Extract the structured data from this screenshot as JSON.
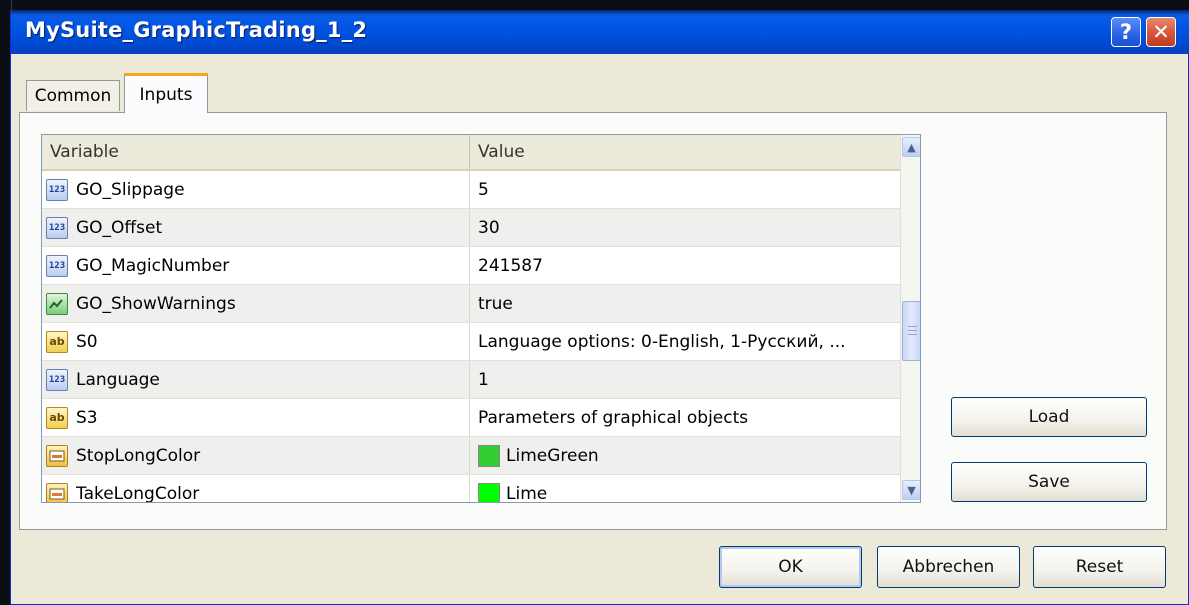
{
  "window": {
    "title": "MySuite_GraphicTrading_1_2",
    "help_label": "?",
    "close_label": "✕"
  },
  "tabs": [
    {
      "label": "Common",
      "active": false
    },
    {
      "label": "Inputs",
      "active": true
    }
  ],
  "grid": {
    "columns": {
      "variable": "Variable",
      "value": "Value"
    },
    "rows": [
      {
        "icon": "number-icon",
        "name": "GO_Slippage",
        "value": "5"
      },
      {
        "icon": "number-icon",
        "name": "GO_Offset",
        "value": "30"
      },
      {
        "icon": "number-icon",
        "name": "GO_MagicNumber",
        "value": "241587"
      },
      {
        "icon": "boolean-icon",
        "name": "GO_ShowWarnings",
        "value": "true"
      },
      {
        "icon": "string-icon",
        "name": "S0",
        "value": "Language options: 0-English, 1-Русский, ..."
      },
      {
        "icon": "number-icon",
        "name": "Language",
        "value": "1"
      },
      {
        "icon": "string-icon",
        "name": "S3",
        "value": " Parameters of graphical objects"
      },
      {
        "icon": "color-icon",
        "name": "StopLongColor",
        "value": "LimeGreen",
        "swatch": "#32cd32"
      },
      {
        "icon": "color-icon",
        "name": "TakeLongColor",
        "value": "Lime",
        "swatch": "#00ff00"
      }
    ]
  },
  "side_buttons": {
    "load": "Load",
    "save": "Save"
  },
  "footer_buttons": {
    "ok": "OK",
    "cancel": "Abbrechen",
    "reset": "Reset"
  },
  "icon_text": {
    "number": "123",
    "string": "ab"
  }
}
